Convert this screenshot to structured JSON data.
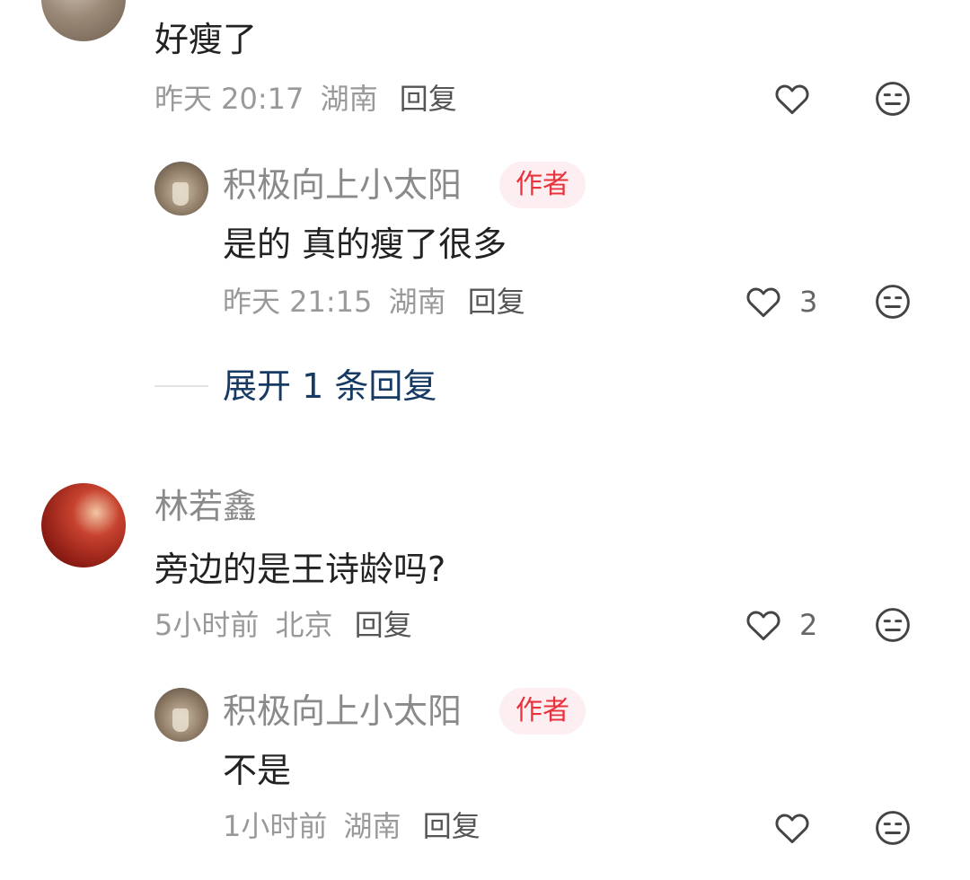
{
  "comments": [
    {
      "avatar_icon": "cat-avatar",
      "text": "好瘦了",
      "time": "昨天 20:17",
      "location": "湖南",
      "reply_label": "回复",
      "replies": [
        {
          "avatar_icon": "author-avatar",
          "username": "积极向上小太阳",
          "badge": "作者",
          "text": "是的 真的瘦了很多",
          "time": "昨天 21:15",
          "location": "湖南",
          "reply_label": "回复",
          "like_count": "3"
        }
      ],
      "expand_label": "展开 1 条回复"
    },
    {
      "avatar_icon": "woman-avatar",
      "username": "林若鑫",
      "text": "旁边的是王诗龄吗?",
      "time": "5小时前",
      "location": "北京",
      "reply_label": "回复",
      "like_count": "2",
      "replies": [
        {
          "avatar_icon": "author-avatar",
          "username": "积极向上小太阳",
          "badge": "作者",
          "text": "不是",
          "time": "1小时前",
          "location": "湖南",
          "reply_label": "回复"
        }
      ]
    }
  ],
  "icons": {
    "like": "heart-outline-icon",
    "dislike": "meh-face-icon"
  },
  "colors": {
    "badge_text": "#e8323c",
    "badge_bg": "#fdeff1",
    "expand_link": "#163a63",
    "meta_text": "#999999"
  }
}
